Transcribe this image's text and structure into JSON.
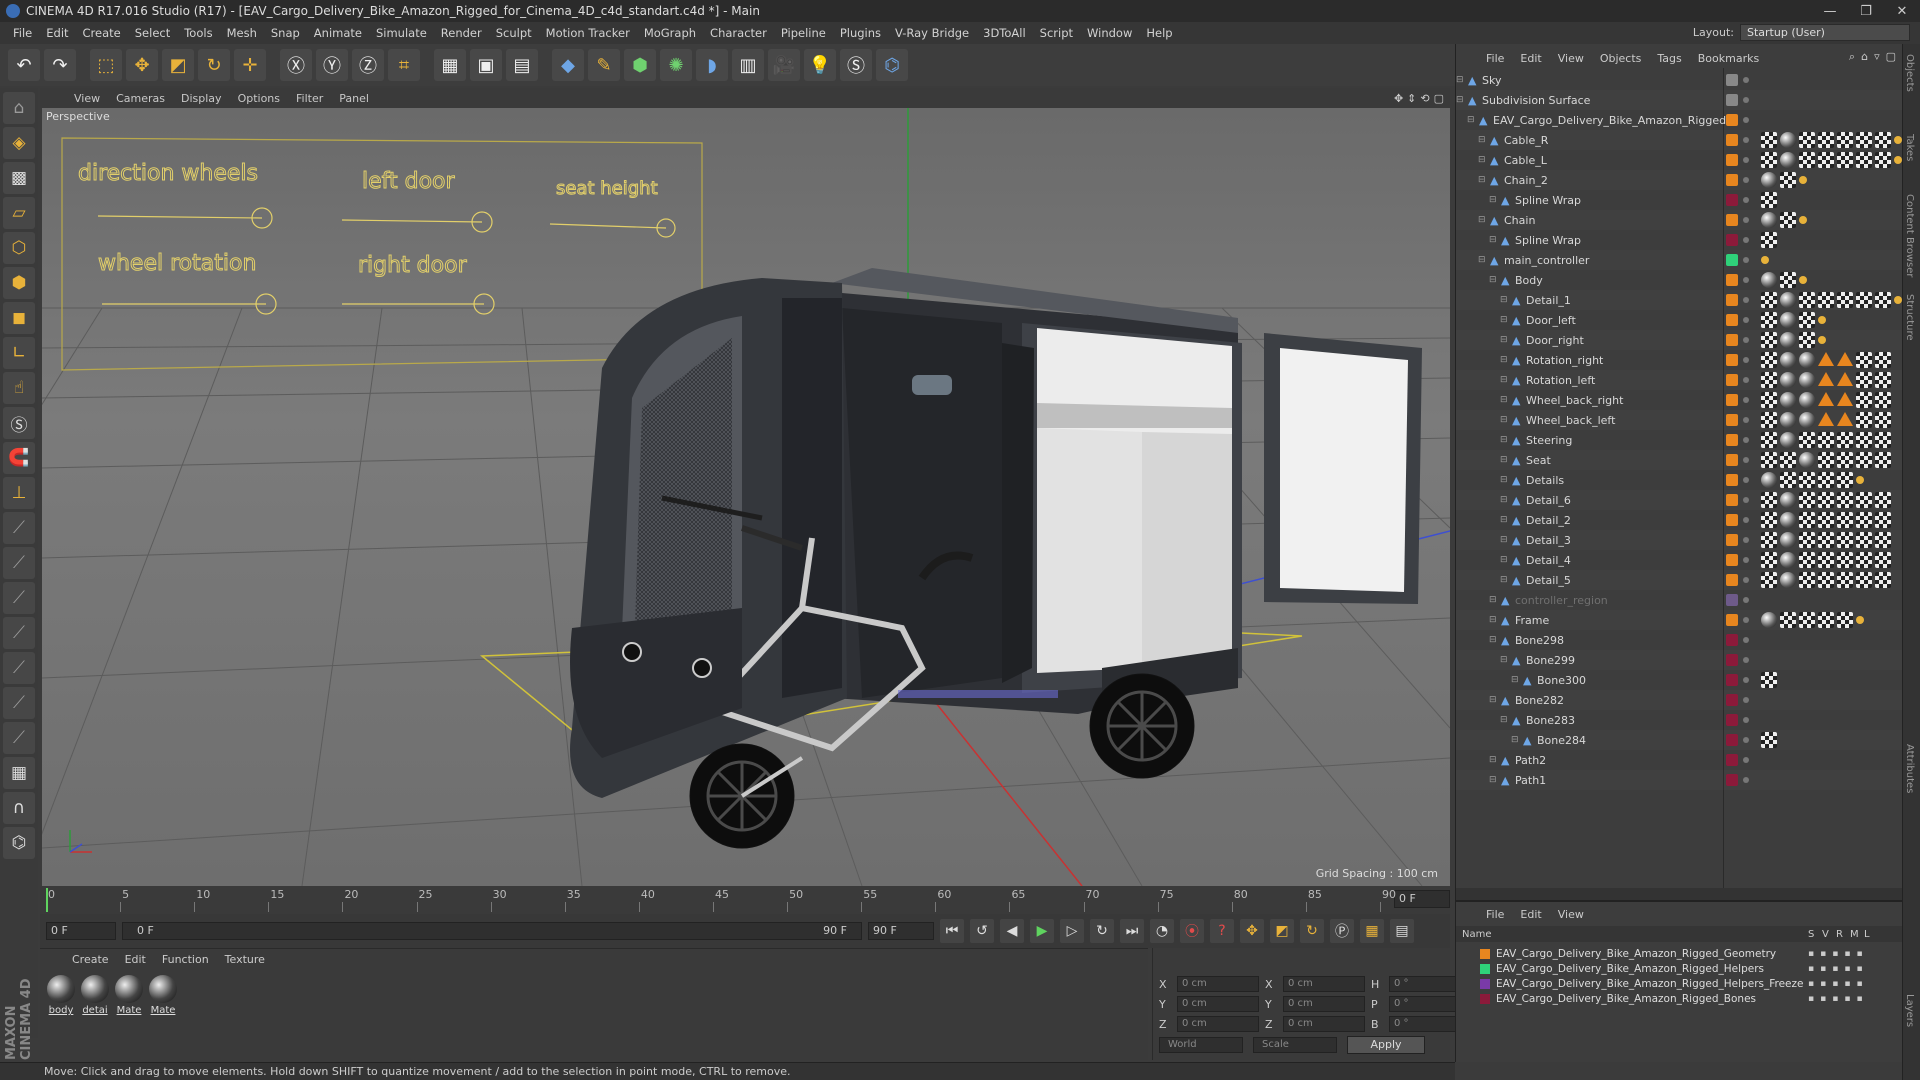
{
  "window": {
    "title": "CINEMA 4D R17.016 Studio (R17) - [EAV_Cargo_Delivery_Bike_Amazon_Rigged_for_Cinema_4D_c4d_standart.c4d *] - Main",
    "controls": [
      "—",
      "❐",
      "✕"
    ]
  },
  "menu": [
    "File",
    "Edit",
    "Create",
    "Select",
    "Tools",
    "Mesh",
    "Snap",
    "Animate",
    "Simulate",
    "Render",
    "Sculpt",
    "Motion Tracker",
    "MoGraph",
    "Character",
    "Pipeline",
    "Plugins",
    "V-Ray Bridge",
    "3DToAll",
    "Script",
    "Window",
    "Help"
  ],
  "layout": {
    "label": "Layout:",
    "value": "Startup (User)"
  },
  "viewport": {
    "menu": [
      "View",
      "Cameras",
      "Display",
      "Options",
      "Filter",
      "Panel"
    ],
    "label": "Perspective",
    "grid_spacing": "Grid Spacing : 100 cm",
    "controls": [
      "direction wheels",
      "left door",
      "seat height",
      "wheel rotation",
      "right door"
    ]
  },
  "timeline": {
    "ticks": [
      "0",
      "5",
      "10",
      "15",
      "20",
      "25",
      "30",
      "35",
      "40",
      "45",
      "50",
      "55",
      "60",
      "65",
      "70",
      "75",
      "80",
      "85",
      "90"
    ],
    "frame_right": "0 F"
  },
  "transport": {
    "start_field": "0 F",
    "slider_left": "0 F",
    "slider_right": "90 F",
    "end_field": "90 F"
  },
  "materials": {
    "menu": [
      "Create",
      "Edit",
      "Function",
      "Texture"
    ],
    "items": [
      "body",
      "detai",
      "Mate",
      "Mate"
    ]
  },
  "coords": {
    "rows": [
      {
        "a": "X",
        "av": "0 cm",
        "b": "X",
        "bv": "0 cm",
        "c": "H",
        "cv": "0 °"
      },
      {
        "a": "Y",
        "av": "0 cm",
        "b": "Y",
        "bv": "0 cm",
        "c": "P",
        "cv": "0 °"
      },
      {
        "a": "Z",
        "av": "0 cm",
        "b": "Z",
        "bv": "0 cm",
        "c": "B",
        "cv": "0 °"
      }
    ],
    "mode": "World",
    "type": "Scale",
    "apply": "Apply"
  },
  "status": "Move: Click and drag to move elements. Hold down SHIFT to quantize movement / add to the selection in point mode, CTRL to remove.",
  "objects": {
    "menu": [
      "File",
      "Edit",
      "View",
      "Objects",
      "Tags",
      "Bookmarks"
    ],
    "rows": [
      {
        "name": "Sky",
        "level": 0,
        "color": "#888888"
      },
      {
        "name": "Subdivision Surface",
        "level": 0,
        "color": "#888888"
      },
      {
        "name": "EAV_Cargo_Delivery_Bike_Amazon_Rigged",
        "level": 1,
        "color": "#e8861f"
      },
      {
        "name": "Cable_R",
        "level": 2,
        "color": "#e8861f"
      },
      {
        "name": "Cable_L",
        "level": 2,
        "color": "#e8861f"
      },
      {
        "name": "Chain_2",
        "level": 2,
        "color": "#e8861f"
      },
      {
        "name": "Spline Wrap",
        "level": 3,
        "color": "#8b1a3a"
      },
      {
        "name": "Chain",
        "level": 2,
        "color": "#e8861f"
      },
      {
        "name": "Spline Wrap",
        "level": 3,
        "color": "#8b1a3a"
      },
      {
        "name": "main_controller",
        "level": 2,
        "color": "#2fd27a"
      },
      {
        "name": "Body",
        "level": 3,
        "color": "#e8861f"
      },
      {
        "name": "Detail_1",
        "level": 4,
        "color": "#e8861f"
      },
      {
        "name": "Door_left",
        "level": 4,
        "color": "#e8861f"
      },
      {
        "name": "Door_right",
        "level": 4,
        "color": "#e8861f"
      },
      {
        "name": "Rotation_right",
        "level": 4,
        "color": "#e8861f"
      },
      {
        "name": "Rotation_left",
        "level": 4,
        "color": "#e8861f"
      },
      {
        "name": "Wheel_back_right",
        "level": 4,
        "color": "#e8861f"
      },
      {
        "name": "Wheel_back_left",
        "level": 4,
        "color": "#e8861f"
      },
      {
        "name": "Steering",
        "level": 4,
        "color": "#e8861f"
      },
      {
        "name": "Seat",
        "level": 4,
        "color": "#e8861f"
      },
      {
        "name": "Details",
        "level": 4,
        "color": "#e8861f"
      },
      {
        "name": "Detail_6",
        "level": 4,
        "color": "#e8861f"
      },
      {
        "name": "Detail_2",
        "level": 4,
        "color": "#e8861f"
      },
      {
        "name": "Detail_3",
        "level": 4,
        "color": "#e8861f"
      },
      {
        "name": "Detail_4",
        "level": 4,
        "color": "#e8861f"
      },
      {
        "name": "Detail_5",
        "level": 4,
        "color": "#e8861f"
      },
      {
        "name": "controller_region",
        "level": 3,
        "color": "#6e5a8a"
      },
      {
        "name": "Frame",
        "level": 3,
        "color": "#e8861f"
      },
      {
        "name": "Bone298",
        "level": 3,
        "color": "#8b1a3a"
      },
      {
        "name": "Bone299",
        "level": 4,
        "color": "#8b1a3a"
      },
      {
        "name": "Bone300",
        "level": 5,
        "color": "#8b1a3a"
      },
      {
        "name": "Bone282",
        "level": 3,
        "color": "#8b1a3a"
      },
      {
        "name": "Bone283",
        "level": 4,
        "color": "#8b1a3a"
      },
      {
        "name": "Bone284",
        "level": 5,
        "color": "#8b1a3a"
      },
      {
        "name": "Path2",
        "level": 3,
        "color": "#8b1a3a"
      },
      {
        "name": "Path1",
        "level": 3,
        "color": "#8b1a3a"
      }
    ]
  },
  "layers": {
    "menu": [
      "File",
      "Edit",
      "View"
    ],
    "header": {
      "name": "Name",
      "s": "S",
      "v": "V",
      "r": "R",
      "m": "M",
      "l": "L"
    },
    "rows": [
      {
        "name": "EAV_Cargo_Delivery_Bike_Amazon_Rigged_Geometry",
        "color": "#e8861f"
      },
      {
        "name": "EAV_Cargo_Delivery_Bike_Amazon_Rigged_Helpers",
        "color": "#2fd27a"
      },
      {
        "name": "EAV_Cargo_Delivery_Bike_Amazon_Rigged_Helpers_Freeze",
        "color": "#7a3aa8"
      },
      {
        "name": "EAV_Cargo_Delivery_Bike_Amazon_Rigged_Bones",
        "color": "#8b1a3a"
      }
    ]
  },
  "side_tabs": [
    "Objects",
    "Takes",
    "Content Browser",
    "Structure",
    "Attributes",
    "Layers"
  ]
}
